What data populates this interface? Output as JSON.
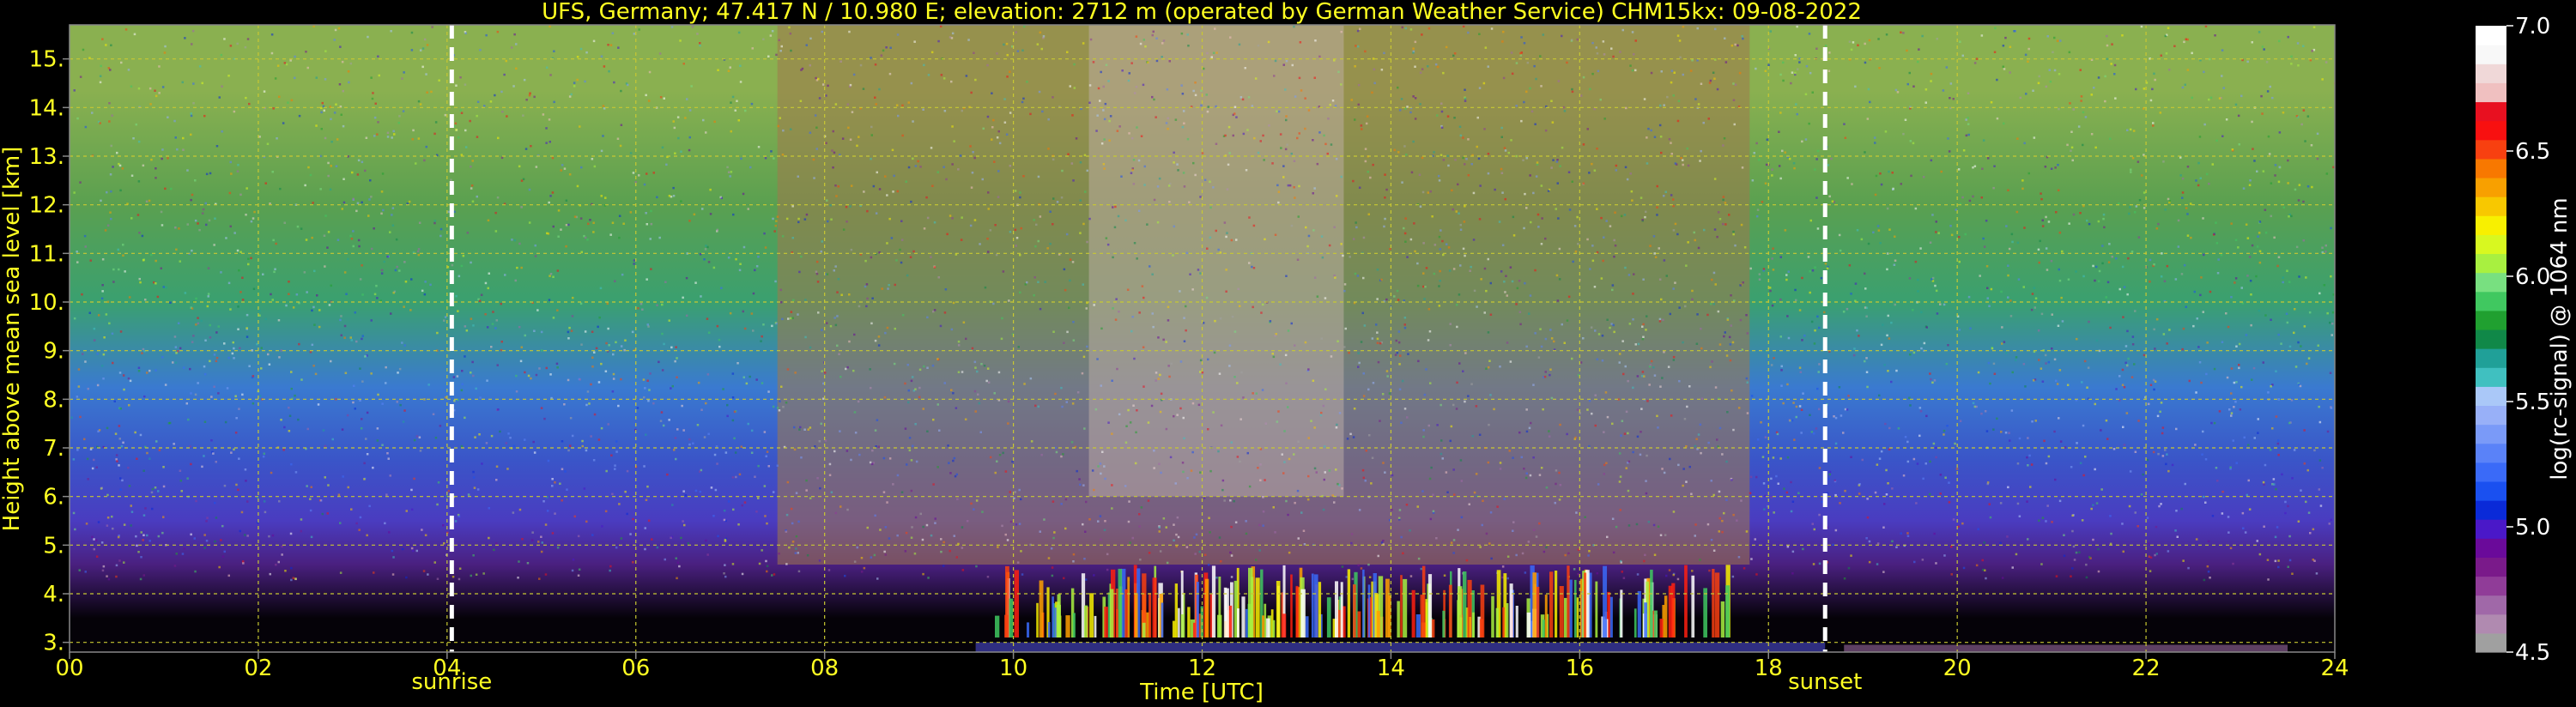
{
  "chart_data": [
    {
      "type": "heatmap",
      "title": "UFS, Germany; 47.417 N / 10.980 E; elevation: 2712 m  (operated by German Weather Service)    CHM15kx: 09-08-2022",
      "xlabel": "Time [UTC]",
      "ylabel": "Height above mean sea level [km]",
      "xlim": [
        0,
        24
      ],
      "ylim": [
        2.8,
        15.7
      ],
      "grid": true,
      "x_ticks": [
        {
          "v": 0,
          "label": "00"
        },
        {
          "v": 2,
          "label": "02"
        },
        {
          "v": 4,
          "label": "04"
        },
        {
          "v": 6,
          "label": "06"
        },
        {
          "v": 8,
          "label": "08"
        },
        {
          "v": 10,
          "label": "10"
        },
        {
          "v": 12,
          "label": "12"
        },
        {
          "v": 14,
          "label": "14"
        },
        {
          "v": 16,
          "label": "16"
        },
        {
          "v": 18,
          "label": "18"
        },
        {
          "v": 20,
          "label": "20"
        },
        {
          "v": 22,
          "label": "22"
        },
        {
          "v": 24,
          "label": "24"
        }
      ],
      "y_ticks": [
        {
          "v": 3,
          "label": "3."
        },
        {
          "v": 4,
          "label": "4."
        },
        {
          "v": 5,
          "label": "5."
        },
        {
          "v": 6,
          "label": "6."
        },
        {
          "v": 7,
          "label": "7."
        },
        {
          "v": 8,
          "label": "8."
        },
        {
          "v": 9,
          "label": "9."
        },
        {
          "v": 10,
          "label": "10."
        },
        {
          "v": 11,
          "label": "11."
        },
        {
          "v": 12,
          "label": "12."
        },
        {
          "v": 13,
          "label": "13."
        },
        {
          "v": 14,
          "label": "14."
        },
        {
          "v": 15,
          "label": "15."
        }
      ],
      "annotations": [
        {
          "x": 4.05,
          "label": "sunrise"
        },
        {
          "x": 18.6,
          "label": "sunset"
        }
      ],
      "bands": [
        {
          "y0": 2.8,
          "y1": 4.2,
          "color": "#050208"
        },
        {
          "y0": 4.2,
          "y1": 5.0,
          "color": "#4a2080"
        },
        {
          "y0": 5.0,
          "y1": 6.0,
          "color": "#4a3cc0"
        },
        {
          "y0": 6.0,
          "y1": 7.5,
          "color": "#3a55c8"
        },
        {
          "y0": 7.5,
          "y1": 9.0,
          "color": "#3a7ad0"
        },
        {
          "y0": 9.0,
          "y1": 11.0,
          "color": "#3aa070"
        },
        {
          "y0": 11.0,
          "y1": 13.0,
          "color": "#5aa050"
        },
        {
          "y0": 13.0,
          "y1": 15.7,
          "color": "#8ab050"
        }
      ],
      "day_region": {
        "x0": 7.5,
        "x1": 17.8,
        "color": "#a0784a"
      },
      "bright_region": {
        "x0": 10.8,
        "x1": 13.5,
        "color": "#c0b0a8"
      },
      "convection": {
        "x0": 9.8,
        "x1": 17.6,
        "y0": 3.1,
        "y1": 4.6
      }
    },
    {
      "type": "colorbar",
      "label": "log(rc-signal) @ 1064 nm",
      "range": [
        4.5,
        7.0
      ],
      "ticks": [
        {
          "v": 4.5,
          "label": "4.5"
        },
        {
          "v": 5.0,
          "label": "5.0"
        },
        {
          "v": 5.5,
          "label": "5.5"
        },
        {
          "v": 6.0,
          "label": "6.0"
        },
        {
          "v": 6.5,
          "label": "6.5"
        },
        {
          "v": 7.0,
          "label": "7.0"
        }
      ],
      "colors": [
        "#a0a0a0",
        "#b08ab0",
        "#a068a8",
        "#903c98",
        "#7a1a8a",
        "#6a0a9a",
        "#4a18c8",
        "#0a2ad8",
        "#1a50f0",
        "#3a6af8",
        "#5a82f8",
        "#7a9af8",
        "#98b0f8",
        "#aac8f8",
        "#40c0c0",
        "#20a098",
        "#108848",
        "#20a030",
        "#40c860",
        "#78e080",
        "#a8f040",
        "#d8f820",
        "#f8f000",
        "#f8c800",
        "#f8a000",
        "#f87800",
        "#f84010",
        "#f81010",
        "#e81020",
        "#f0c0c0",
        "#f0d8d8",
        "#f8f8f8",
        "#ffffff"
      ]
    }
  ]
}
